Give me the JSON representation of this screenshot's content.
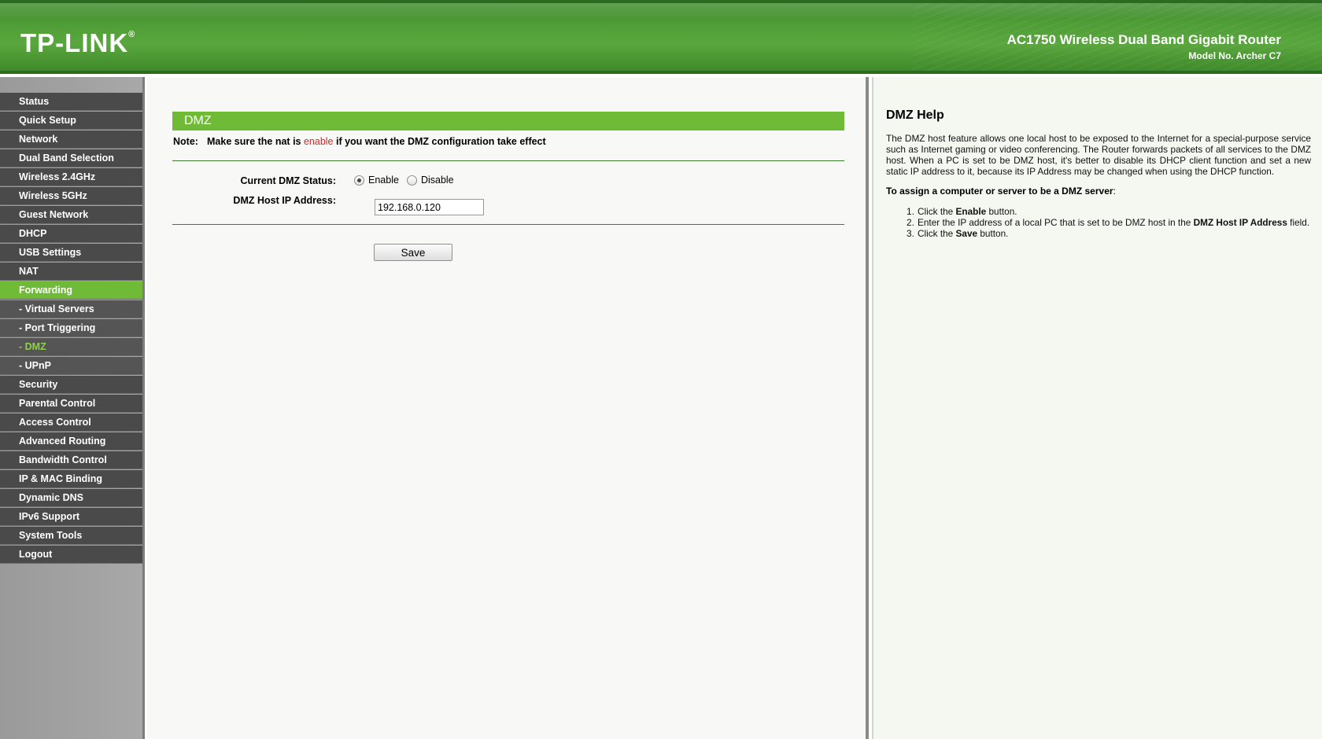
{
  "header": {
    "logo": "TP-LINK",
    "logo_mark": "®",
    "product_title": "AC1750 Wireless Dual Band Gigabit Router",
    "model_no": "Model No. Archer C7"
  },
  "sidebar": {
    "items": [
      {
        "label": "Status",
        "state": "normal"
      },
      {
        "label": "Quick Setup",
        "state": "normal"
      },
      {
        "label": "Network",
        "state": "normal"
      },
      {
        "label": "Dual Band Selection",
        "state": "normal"
      },
      {
        "label": "Wireless 2.4GHz",
        "state": "normal"
      },
      {
        "label": "Wireless 5GHz",
        "state": "normal"
      },
      {
        "label": "Guest Network",
        "state": "normal"
      },
      {
        "label": "DHCP",
        "state": "normal"
      },
      {
        "label": "USB Settings",
        "state": "normal"
      },
      {
        "label": "NAT",
        "state": "normal"
      },
      {
        "label": "Forwarding",
        "state": "active"
      },
      {
        "label": "- Virtual Servers",
        "state": "sub"
      },
      {
        "label": "- Port Triggering",
        "state": "sub"
      },
      {
        "label": "- DMZ",
        "state": "sub-current"
      },
      {
        "label": "- UPnP",
        "state": "sub"
      },
      {
        "label": "Security",
        "state": "normal"
      },
      {
        "label": "Parental Control",
        "state": "normal"
      },
      {
        "label": "Access Control",
        "state": "normal"
      },
      {
        "label": "Advanced Routing",
        "state": "normal"
      },
      {
        "label": "Bandwidth Control",
        "state": "normal"
      },
      {
        "label": "IP & MAC Binding",
        "state": "normal"
      },
      {
        "label": "Dynamic DNS",
        "state": "normal"
      },
      {
        "label": "IPv6 Support",
        "state": "normal"
      },
      {
        "label": "System Tools",
        "state": "normal"
      },
      {
        "label": "Logout",
        "state": "normal"
      }
    ]
  },
  "main": {
    "section_title": "DMZ",
    "note": {
      "label": "Note:",
      "before": "Make sure the nat is ",
      "highlight": "enable",
      "after": " if you want the DMZ configuration take effect"
    },
    "dmz_status_label": "Current DMZ Status:",
    "enable_label": "Enable",
    "disable_label": "Disable",
    "selected_status": "Enable",
    "host_ip_label": "DMZ Host IP Address:",
    "host_ip_value": "192.168.0.120",
    "save_label": "Save"
  },
  "help": {
    "title": "DMZ Help",
    "body": "The DMZ host feature allows one local host to be exposed to the Internet for a special-purpose service such as Internet gaming or video conferencing. The Router forwards packets of all services to the DMZ host. When a PC is set to be DMZ host, it's better to disable its DHCP client function and set a new static IP address to it, because its IP Address may be changed when using the DHCP function.",
    "subtitle_bold": "To assign a computer or server to be a DMZ server",
    "subtitle_tail": ":",
    "steps": [
      {
        "pre": "Click the ",
        "bold": "Enable",
        "post": " button."
      },
      {
        "pre": "Enter the IP address of a local PC that is set to be DMZ host in the ",
        "bold": "DMZ Host IP Address",
        "post": " field."
      },
      {
        "pre": "Click the ",
        "bold": "Save",
        "post": " button."
      }
    ]
  },
  "colors": {
    "brand_green": "#6fba36",
    "header_green": "#4f9d37",
    "menu_dark": "#4a4a4a",
    "note_red": "#cc2a2a"
  }
}
